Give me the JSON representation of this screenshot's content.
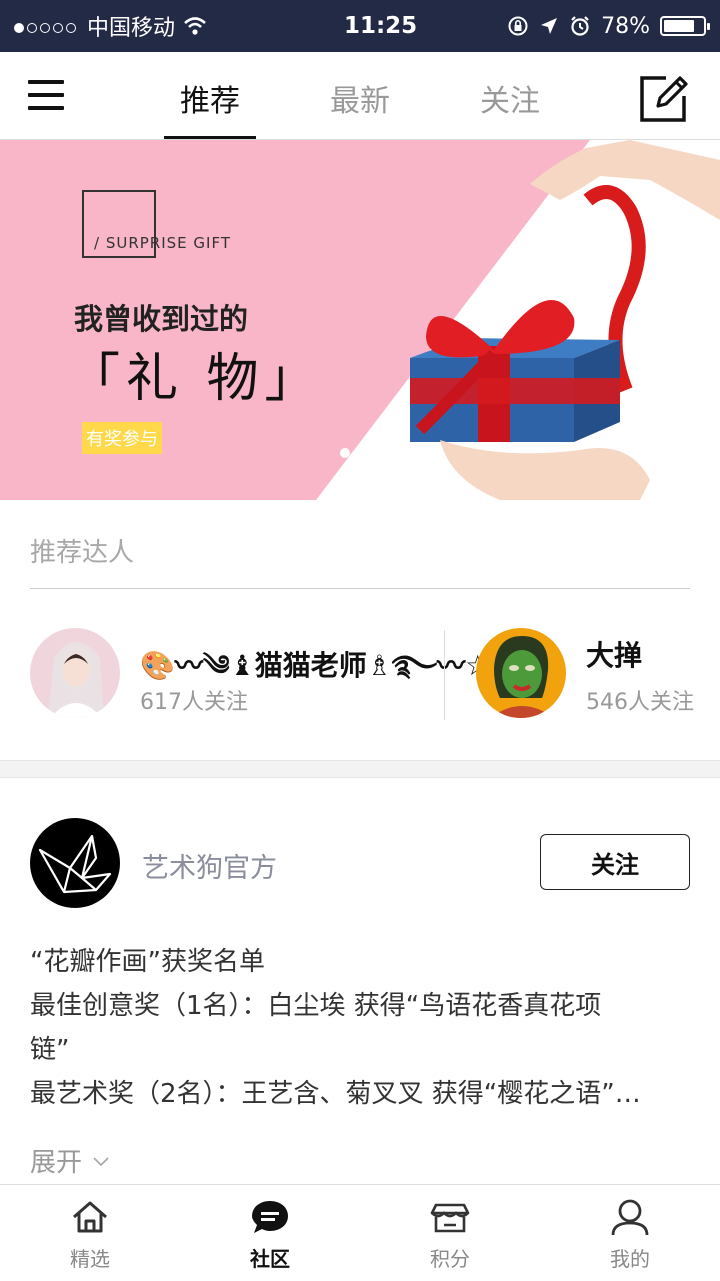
{
  "status_bar": {
    "carrier": "中国移动",
    "time": "11:25",
    "battery": "78%",
    "battery_level": 0.78
  },
  "nav": {
    "tabs": [
      {
        "label": "推荐",
        "active": true
      },
      {
        "label": "最新",
        "active": false
      },
      {
        "label": "关注",
        "active": false
      }
    ]
  },
  "banner": {
    "tag": "/ SURPRISE GIFT",
    "line1": "我曾收到过的",
    "line2": "「礼 物」",
    "button": "有奖参与",
    "colors": {
      "pink": "#f8b6c8",
      "accent": "#ffd94a"
    }
  },
  "recommended": {
    "title": "推荐达人",
    "users": [
      {
        "name": "🎨〰༄♝猫猫老师♗࿐〰☆",
        "followers": "617人关注"
      },
      {
        "name": "大掸",
        "followers": "546人关注"
      }
    ]
  },
  "post": {
    "author": "艺术狗官方",
    "follow_label": "关注",
    "lines": [
      "“花瓣作画”获奖名单",
      "最佳创意奖（1名）：白尘埃 获得“鸟语花香真花项",
      "链”",
      "最艺术奖（2名）：王艺含、菊叉叉 获得“樱花之语”…"
    ],
    "expand_label": "展开"
  },
  "tabbar": {
    "items": [
      {
        "label": "精选",
        "icon": "home-icon",
        "active": false
      },
      {
        "label": "社区",
        "icon": "chat-icon",
        "active": true
      },
      {
        "label": "积分",
        "icon": "shop-icon",
        "active": false
      },
      {
        "label": "我的",
        "icon": "person-icon",
        "active": false
      }
    ]
  }
}
